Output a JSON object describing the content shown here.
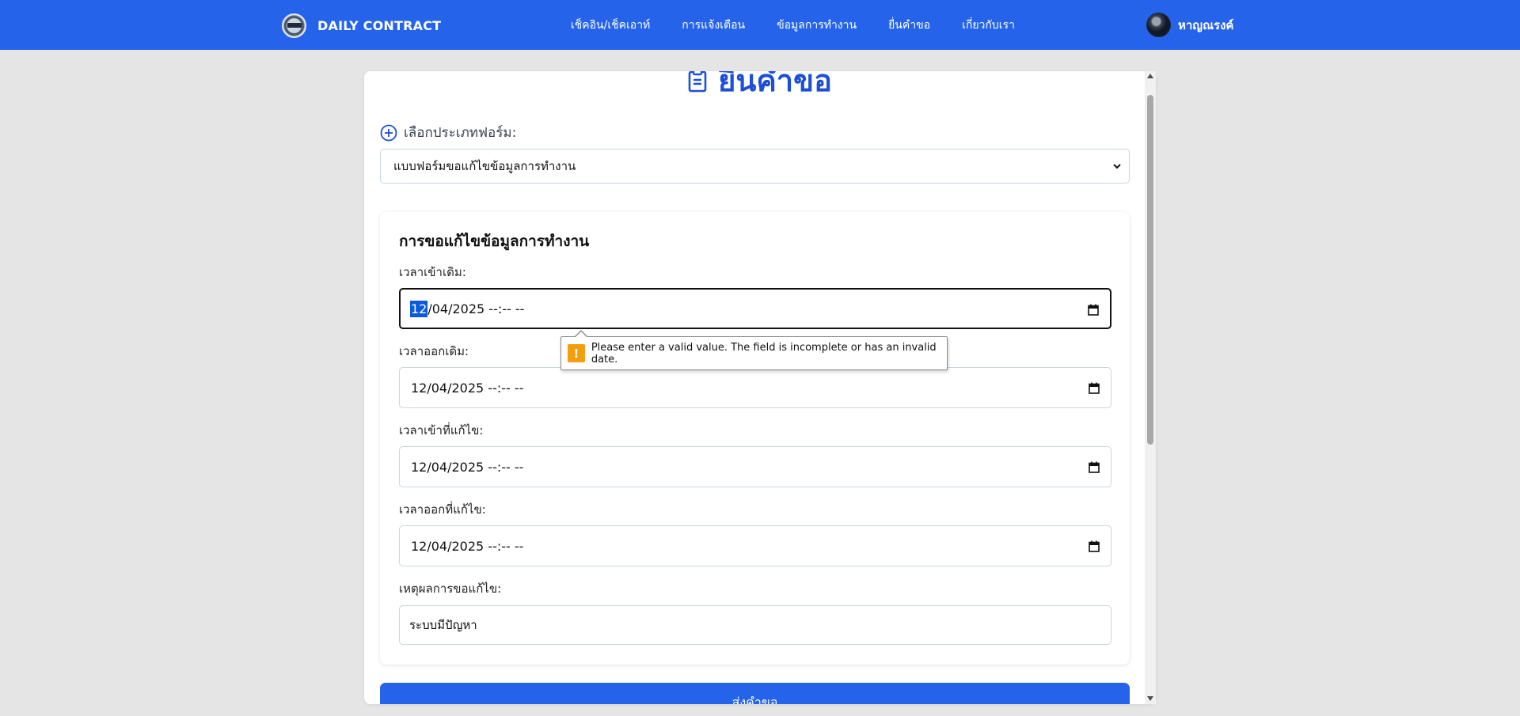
{
  "header": {
    "brand": "DAILY CONTRACT",
    "nav": [
      "เช็คอิน/เช็คเอาท์",
      "การแจ้งเตือน",
      "ข้อมูลการทำงาน",
      "ยื่นคำขอ",
      "เกี่ยวกับเรา"
    ],
    "user_name": "หาญณรงค์"
  },
  "page": {
    "title": "ยื่นคำขอ",
    "form_type_label": "เลือกประเภทฟอร์ม:",
    "form_type_selected": "แบบฟอร์มขอแก้ไขข้อมูลการทำงาน"
  },
  "section": {
    "title": "การขอแก้ไขข้อมูลการทำงาน",
    "fields": [
      {
        "label": "เวลาเข้าเดิม:",
        "day": "12",
        "rest": "/04/2025 --:-- --"
      },
      {
        "label": "เวลาออกเดิม:",
        "value": "12/04/2025 --:-- --"
      },
      {
        "label": "เวลาเข้าที่แก้ไข:",
        "value": "12/04/2025 --:-- --"
      },
      {
        "label": "เวลาออกที่แก้ไข:",
        "value": "12/04/2025 --:-- --"
      },
      {
        "label": "เหตุผลการขอแก้ไข:",
        "value": "ระบบมีปัญหา"
      }
    ]
  },
  "tooltip": {
    "message": "Please enter a valid value. The field is incomplete or has an invalid date.",
    "icon": "!"
  },
  "submit_label": "ส่งคำขอ",
  "icons": {
    "brand": "brand-logo-icon",
    "avatar": "avatar",
    "title": "clipboard-icon",
    "form_type": "plus-circle-icon",
    "select": "chevron-down-icon",
    "date": "calendar-icon",
    "warning": "warning-icon"
  },
  "colors": {
    "primary": "#2563eb",
    "title": "#1d4ed8",
    "warning": "#f59e0b",
    "selection": "#0b5ad9"
  }
}
